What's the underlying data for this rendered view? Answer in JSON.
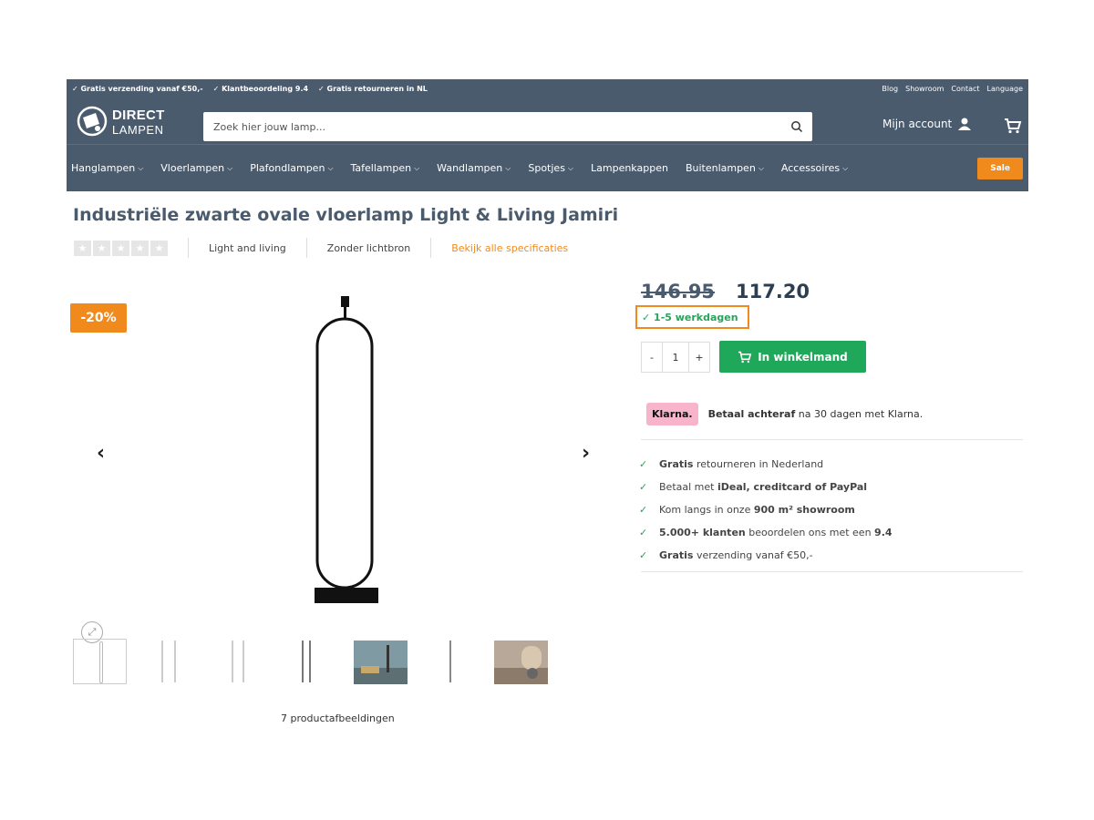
{
  "topbar": {
    "usps": [
      "✓ Gratis verzending vanaf €50,-",
      "✓ Klantbeoordeling 9.4",
      "✓ Gratis retourneren in NL"
    ],
    "links": [
      "Blog",
      "Showroom",
      "Contact",
      "Language"
    ]
  },
  "header": {
    "logo_line1": "DIRECT",
    "logo_line2": "LAMPEN",
    "search_placeholder": "Zoek hier jouw lamp...",
    "account_label": "Mijn account"
  },
  "nav": {
    "items": [
      {
        "label": "Hanglampen",
        "dropdown": true
      },
      {
        "label": "Vloerlampen",
        "dropdown": true
      },
      {
        "label": "Plafondlampen",
        "dropdown": true
      },
      {
        "label": "Tafellampen",
        "dropdown": true
      },
      {
        "label": "Wandlampen",
        "dropdown": true
      },
      {
        "label": "Spotjes",
        "dropdown": true
      },
      {
        "label": "Lampenkappen",
        "dropdown": false
      },
      {
        "label": "Buitenlampen",
        "dropdown": true
      },
      {
        "label": "Accessoires",
        "dropdown": true
      }
    ],
    "sale_label": "Sale"
  },
  "product": {
    "title": "Industriële zwarte ovale vloerlamp Light & Living Jamiri",
    "rating_stars": 0,
    "brand": "Light and living",
    "lightsource": "Zonder lichtbron",
    "spec_link": "Bekijk alle specificaties",
    "discount_badge": "-20%",
    "image_count_label": "7 productafbeeldingen",
    "old_price": "146.95",
    "price": "117.20",
    "delivery": "✓ 1-5 werkdagen",
    "quantity": "1",
    "qty_minus": "-",
    "qty_plus": "+",
    "add_to_cart_label": "In winkelmand"
  },
  "klarna": {
    "logo_text": "Klarna.",
    "bold": "Betaal achteraf",
    "rest": " na 30 dagen met Klarna."
  },
  "usps": [
    {
      "bold_first": true,
      "a": "Gratis",
      "b": " retourneren in Nederland",
      "c": ""
    },
    {
      "bold_first": false,
      "a": "Betaal met ",
      "b": "iDeal, creditcard of PayPal",
      "c": ""
    },
    {
      "bold_first": false,
      "a": "Kom langs in onze ",
      "b": "900 m² showroom",
      "c": ""
    },
    {
      "bold_first": true,
      "a": "5.000+ klanten",
      "b": " beoordelen ons met een ",
      "c": "9.4"
    },
    {
      "bold_first": true,
      "a": "Gratis",
      "b": " verzending vanaf €50,-",
      "c": ""
    }
  ],
  "colors": {
    "header_bg": "#4a5b6e",
    "accent_orange": "#f08a1c",
    "green": "#20a85a",
    "klarna_pink": "#f7b4ca"
  }
}
